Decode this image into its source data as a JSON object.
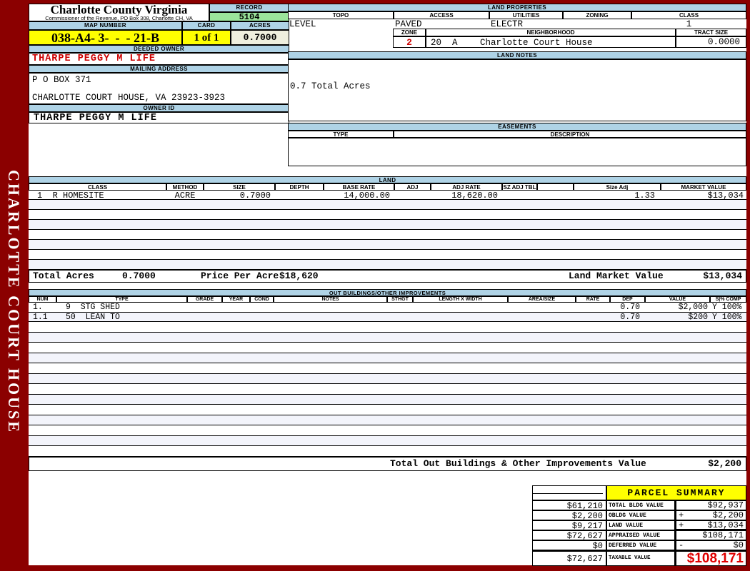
{
  "sidebar": {
    "text": "CHARLOTTE COURT HOUSE"
  },
  "header": {
    "county_title": "Charlotte County Virginia",
    "commissioner_line": "Commissioner of the Revenue, PO Box 308, Charlotte CH, VA",
    "record_label": "RECORD",
    "record_value": "5104",
    "map_number_label": "MAP NUMBER",
    "map_number_value": "038-A4- 3-  -  - 21-B",
    "card_label": "CARD",
    "card_value": "1 of 1",
    "acres_label": "ACRES",
    "acres_value": "0.7000"
  },
  "owner": {
    "deeded_owner_label": "DEEDED OWNER",
    "deeded_owner": "THARPE PEGGY M LIFE",
    "mailing_address_label": "MAILING ADDRESS",
    "address_line1": "P O BOX 371",
    "address_line2": "CHARLOTTE COURT HOUSE, VA 23923-3923",
    "owner_id_label": "OWNER ID",
    "owner_id": "THARPE PEGGY M LIFE"
  },
  "land_properties": {
    "title": "LAND PROPERTIES",
    "topo_label": "TOPO",
    "topo": "LEVEL",
    "access_label": "ACCESS",
    "access": "PAVED",
    "utilities_label": "UTILITIES",
    "utilities": "ELECTR",
    "zoning_label": "ZONING",
    "zoning": "",
    "class_label": "CLASS",
    "class_value": "1",
    "zone_label": "ZONE",
    "zone": "2",
    "neighborhood_label": "NEIGHBORHOOD",
    "neighborhood_code": "20  A",
    "neighborhood_name": "Charlotte Court House",
    "tract_size_label": "TRACT SIZE",
    "tract_size": "0.0000"
  },
  "land_notes": {
    "title": "LAND NOTES",
    "note": "0.7 Total Acres"
  },
  "easements": {
    "title": "EASEMENTS",
    "type_label": "TYPE",
    "description_label": "DESCRIPTION"
  },
  "land": {
    "title": "LAND",
    "headers": [
      "CLASS",
      "METHOD",
      "SIZE",
      "DEPTH",
      "BASE RATE",
      "ADJ",
      "ADJ RATE",
      "SZ ADJ TBL",
      "",
      "Size Adj",
      "MARKET VALUE"
    ],
    "row": {
      "class_value": "1  R HOMESITE",
      "method": "ACRE",
      "size": "0.7000",
      "depth": "",
      "base_rate": "14,000.00",
      "adj": "",
      "adj_rate": "18,620.00",
      "sz_adj_tbl": "",
      "size_adj": "1.33",
      "market_value": "$13,034"
    },
    "total_acres_label": "Total Acres",
    "total_acres": "0.7000",
    "price_per_acre_label": "Price Per Acre",
    "price_per_acre": "$18,620",
    "land_market_value_label": "Land Market Value",
    "land_market_value": "$13,034"
  },
  "outbuildings": {
    "title": "OUT BUILDINGS/OTHER IMPROVEMENTS",
    "headers": [
      "NUM",
      "TYPE",
      "GRADE",
      "YEAR",
      "COND",
      "NOTES",
      "STHGT",
      "LENGTH X WIDTH",
      "AREA/SIZE",
      "RATE",
      "DEP",
      "VALUE",
      "S|% COMP"
    ],
    "rows": [
      {
        "num": "1.",
        "type": "9  STG SHED",
        "dep": "0.70",
        "value": "$2,000",
        "comp": "Y 100%"
      },
      {
        "num": "1.1",
        "type": "50  LEAN TO",
        "dep": "0.70",
        "value": "$200",
        "comp": "Y 100%"
      }
    ],
    "total_label": "Total Out Buildings & Other Improvements Value",
    "total_value": "$2,200"
  },
  "parcel_summary": {
    "title": "PARCEL SUMMARY",
    "rows": [
      {
        "left": "$61,210",
        "label": "TOTAL BLDG VALUE",
        "sign": "",
        "value": "$92,937"
      },
      {
        "left": "$2,200",
        "label": "OBLDG VALUE",
        "sign": "+",
        "value": "$2,200"
      },
      {
        "left": "$9,217",
        "label": "LAND VALUE",
        "sign": "+",
        "value": "$13,034"
      },
      {
        "left": "$72,627",
        "label": "APPRAISED VALUE",
        "sign": "",
        "value": "$108,171"
      },
      {
        "left": "$0",
        "label": "DEFERRED VALUE",
        "sign": "-",
        "value": "$0"
      }
    ],
    "taxable_left": "$72,627",
    "taxable_label": "TAXABLE VALUE",
    "taxable_value": "$108,171"
  },
  "colors": {
    "frame_maroon": "#8B0000",
    "header_blue": "#AFD3E6",
    "record_green": "#9BE49B",
    "highlight_yellow": "#FFFF00",
    "cream": "#EFEFDE",
    "stripe_blue": "#F3F4FB",
    "accent_red": "#CC0000",
    "taxable_red": "#E00000"
  }
}
